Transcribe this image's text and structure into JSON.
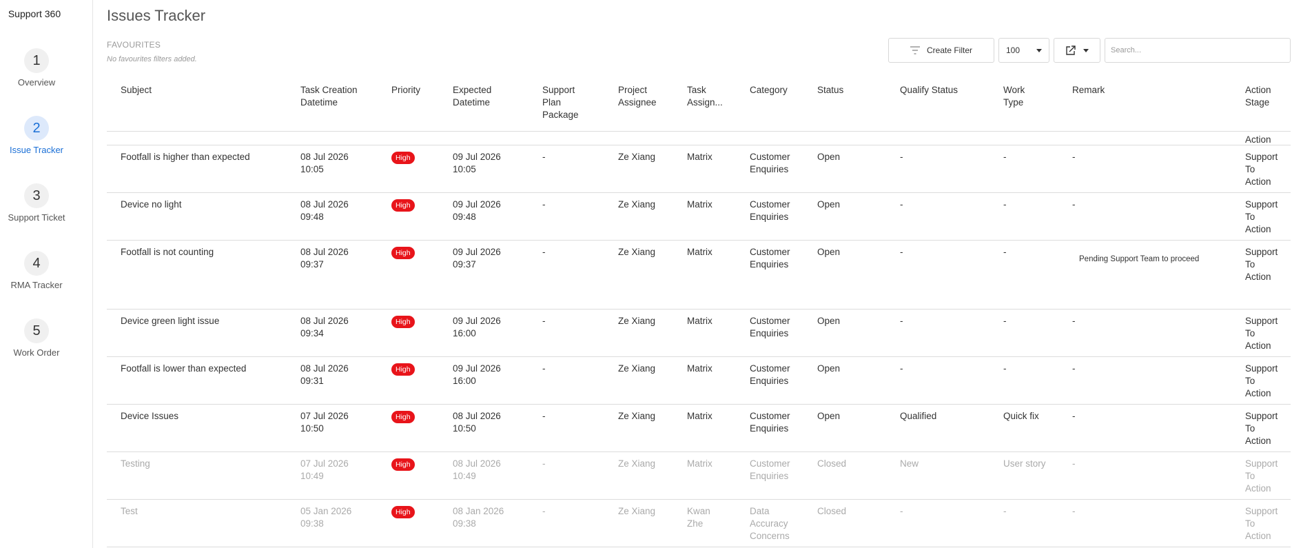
{
  "sidebar": {
    "brand": "Support 360",
    "steps": [
      {
        "number": "1",
        "label": "Overview"
      },
      {
        "number": "2",
        "label": "Issue Tracker"
      },
      {
        "number": "3",
        "label": "Support Ticket"
      },
      {
        "number": "4",
        "label": "RMA Tracker"
      },
      {
        "number": "5",
        "label": "Work Order"
      }
    ]
  },
  "header": {
    "title": "Issues Tracker",
    "favourites_title": "FAVOURITES",
    "favourites_empty": "No favourites filters added."
  },
  "toolbar": {
    "create_filter_label": "Create Filter",
    "page_size": "100",
    "search_placeholder": "Search..."
  },
  "table": {
    "columns": [
      [
        "Subject"
      ],
      [
        "Task Creation",
        "Datetime"
      ],
      [
        "Priority"
      ],
      [
        "Expected",
        "Datetime"
      ],
      [
        "Support",
        "Plan",
        "Package"
      ],
      [
        "Project",
        "Assignee"
      ],
      [
        "Task",
        "Assign..."
      ],
      [
        "Category"
      ],
      [
        "Status"
      ],
      [
        "Qualify Status"
      ],
      [
        "Work",
        "Type"
      ],
      [
        "Remark"
      ],
      [
        "Action",
        "Stage"
      ]
    ],
    "partial_row_action": "Action",
    "rows": [
      {
        "subject": "Footfall is higher than expected",
        "created": [
          "08 Jul 2026",
          "10:05"
        ],
        "priority": "High",
        "expected": [
          "09 Jul 2026",
          "10:05"
        ],
        "package": "-",
        "project_assignee": "Ze Xiang",
        "task_assignee": [
          "Matrix"
        ],
        "category": [
          "Customer",
          "Enquiries"
        ],
        "status": "Open",
        "qualify": "-",
        "work_type": "-",
        "remark": "-",
        "action": [
          "Support",
          "To",
          "Action"
        ],
        "closed": false
      },
      {
        "subject": "Device no light",
        "created": [
          "08 Jul 2026",
          "09:48"
        ],
        "priority": "High",
        "expected": [
          "09 Jul 2026",
          "09:48"
        ],
        "package": "-",
        "project_assignee": "Ze Xiang",
        "task_assignee": [
          "Matrix"
        ],
        "category": [
          "Customer",
          "Enquiries"
        ],
        "status": "Open",
        "qualify": "-",
        "work_type": "-",
        "remark": "-",
        "action": [
          "Support",
          "To",
          "Action"
        ],
        "closed": false
      },
      {
        "subject": "Footfall is not counting",
        "created": [
          "08 Jul 2026",
          "09:37"
        ],
        "priority": "High",
        "expected": [
          "09 Jul 2026",
          "09:37"
        ],
        "package": "-",
        "project_assignee": "Ze Xiang",
        "task_assignee": [
          "Matrix"
        ],
        "category": [
          "Customer",
          "Enquiries"
        ],
        "status": "Open",
        "qualify": "-",
        "work_type": "-",
        "remark": "Pending Support Team to proceed",
        "action": [
          "Support",
          "To",
          "Action"
        ],
        "closed": false
      },
      {
        "subject": "Device green light issue",
        "created": [
          "08 Jul 2026",
          "09:34"
        ],
        "priority": "High",
        "expected": [
          "09 Jul 2026",
          "16:00"
        ],
        "package": "-",
        "project_assignee": "Ze Xiang",
        "task_assignee": [
          "Matrix"
        ],
        "category": [
          "Customer",
          "Enquiries"
        ],
        "status": "Open",
        "qualify": "-",
        "work_type": "-",
        "remark": "-",
        "action": [
          "Support",
          "To",
          "Action"
        ],
        "closed": false
      },
      {
        "subject": "Footfall is lower than expected",
        "created": [
          "08 Jul 2026",
          "09:31"
        ],
        "priority": "High",
        "expected": [
          "09 Jul 2026",
          "16:00"
        ],
        "package": "-",
        "project_assignee": "Ze Xiang",
        "task_assignee": [
          "Matrix"
        ],
        "category": [
          "Customer",
          "Enquiries"
        ],
        "status": "Open",
        "qualify": "-",
        "work_type": "-",
        "remark": "-",
        "action": [
          "Support",
          "To",
          "Action"
        ],
        "closed": false
      },
      {
        "subject": "Device Issues",
        "created": [
          "07 Jul 2026",
          "10:50"
        ],
        "priority": "High",
        "expected": [
          "08 Jul 2026",
          "10:50"
        ],
        "package": "-",
        "project_assignee": "Ze Xiang",
        "task_assignee": [
          "Matrix"
        ],
        "category": [
          "Customer",
          "Enquiries"
        ],
        "status": "Open",
        "qualify": "Qualified",
        "work_type": "Quick fix",
        "remark": "-",
        "action": [
          "Support",
          "To",
          "Action"
        ],
        "closed": false
      },
      {
        "subject": "Testing",
        "created": [
          "07 Jul 2026",
          "10:49"
        ],
        "priority": "High",
        "expected": [
          "08 Jul 2026",
          "10:49"
        ],
        "package": "-",
        "project_assignee": "Ze Xiang",
        "task_assignee": [
          "Matrix"
        ],
        "category": [
          "Customer",
          "Enquiries"
        ],
        "status": "Closed",
        "qualify": "New",
        "work_type": "User story",
        "remark": "-",
        "action": [
          "Support",
          "To",
          "Action"
        ],
        "closed": true
      },
      {
        "subject": "Test",
        "created": [
          "05 Jan 2026",
          "09:38"
        ],
        "priority": "High",
        "expected": [
          "08 Jan 2026",
          "09:38"
        ],
        "package": "-",
        "project_assignee": "Ze Xiang",
        "task_assignee": [
          "Kwan",
          "Zhe"
        ],
        "category": [
          "Data",
          "Accuracy",
          "Concerns"
        ],
        "status": "Closed",
        "qualify": "-",
        "work_type": "-",
        "remark": "-",
        "action": [
          "Support",
          "To",
          "Action"
        ],
        "closed": true
      }
    ]
  },
  "colors": {
    "accent": "#1a6fd6",
    "priority_high": "#e8141a",
    "closed_text": "#aaaaaa"
  }
}
